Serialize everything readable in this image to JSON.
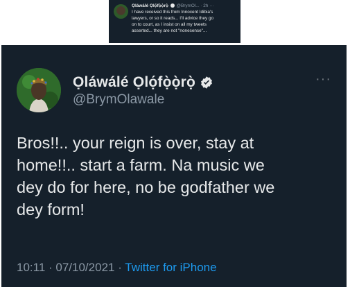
{
  "quoted": {
    "name": "Ọláwálé Ọlọ́fọ̀ọ̀rọ̀",
    "handle": "@BrymOl...",
    "time": "2h",
    "more": "···",
    "lines": [
      "I have received this from Innocent Idibia's",
      "lawyers, or so it reads... I'll advice they go",
      "on to court, as I insist on all my tweets",
      "asserted... they are not \"nonesense\"..."
    ]
  },
  "tweet": {
    "name": "Ọláwálé Ọlọ́fọ̀ọ̀rọ̀",
    "handle": "@BrymOlawale",
    "more": "···",
    "text_lines": [
      "Bros!!.. your reign is over, stay at",
      "home!!.. start a farm. Na music we",
      "dey do for here, no be godfather we",
      "dey form!"
    ],
    "time": "10:11",
    "date": "07/10/2021",
    "separator": " · ",
    "source": "Twitter for iPhone"
  },
  "colors": {
    "background": "#15202b",
    "text": "#e7e9ea",
    "muted": "#8b98a5",
    "link": "#1d9bf0"
  }
}
